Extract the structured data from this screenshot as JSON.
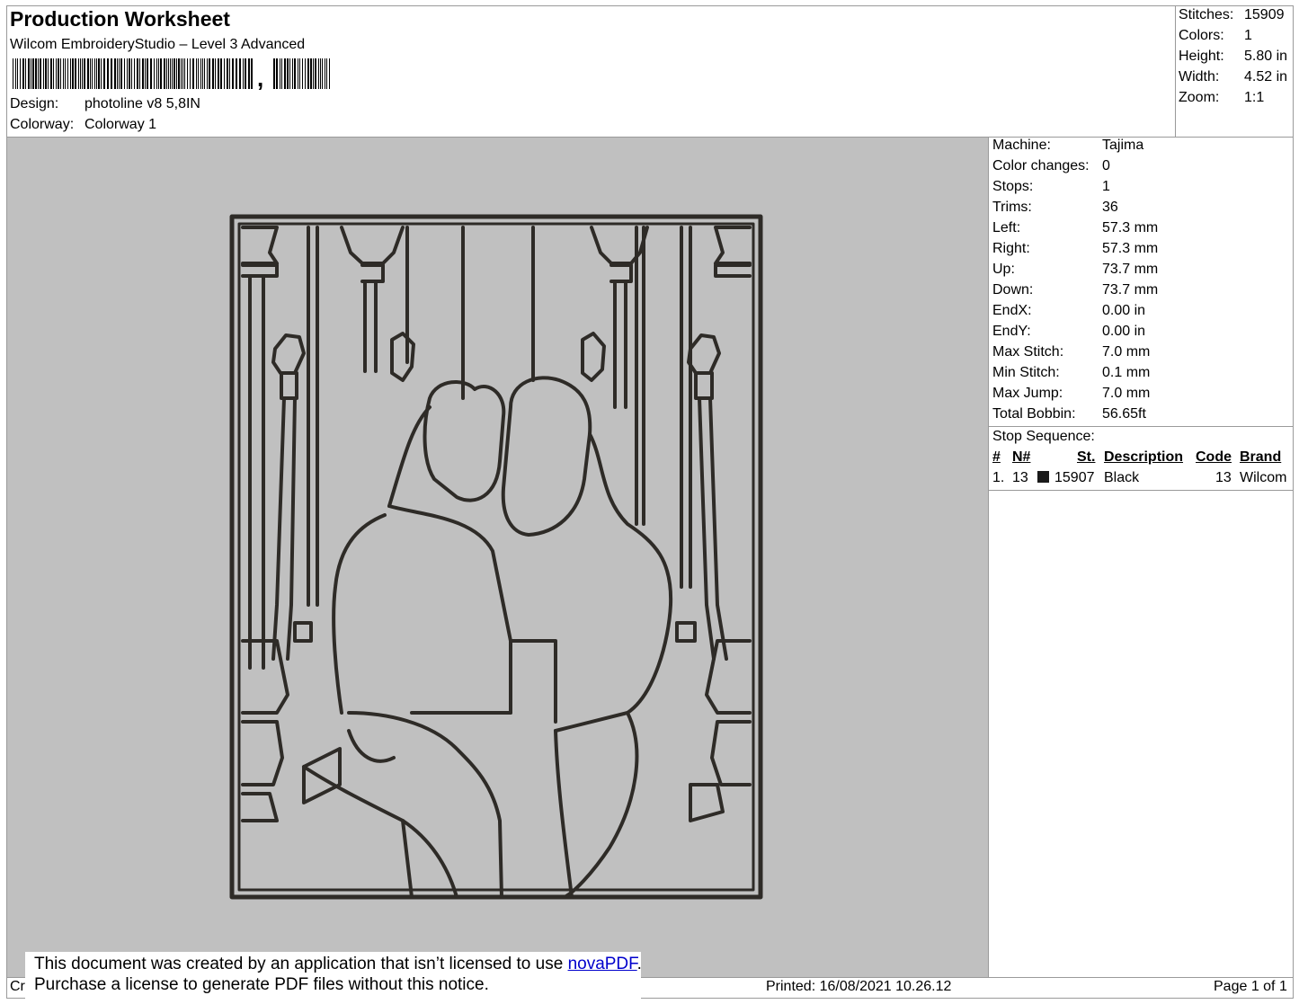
{
  "header": {
    "title": "Production Worksheet",
    "subtitle": "Wilcom EmbroideryStudio – Level 3 Advanced",
    "barcode_char": ",",
    "design_label": "Design:",
    "design_value": "photoline v8 5,8IN",
    "colorway_label": "Colorway:",
    "colorway_value": "Colorway 1"
  },
  "summary": {
    "stitches_label": "Stitches:",
    "stitches_value": "15909",
    "colors_label": "Colors:",
    "colors_value": "1",
    "height_label": "Height:",
    "height_value": "5.80 in",
    "width_label": "Width:",
    "width_value": "4.52 in",
    "zoom_label": "Zoom:",
    "zoom_value": "1:1"
  },
  "specs": [
    {
      "label": "Machine:",
      "value": "Tajima"
    },
    {
      "label": "Color changes:",
      "value": "0"
    },
    {
      "label": "Stops:",
      "value": "1"
    },
    {
      "label": "Trims:",
      "value": "36"
    },
    {
      "label": "Left:",
      "value": "57.3 mm"
    },
    {
      "label": "Right:",
      "value": "57.3 mm"
    },
    {
      "label": "Up:",
      "value": "73.7 mm"
    },
    {
      "label": "Down:",
      "value": "73.7 mm"
    },
    {
      "label": "EndX:",
      "value": "0.00 in"
    },
    {
      "label": "EndY:",
      "value": "0.00 in"
    },
    {
      "label": "Max Stitch:",
      "value": "7.0 mm"
    },
    {
      "label": "Min Stitch:",
      "value": "0.1 mm"
    },
    {
      "label": "Max Jump:",
      "value": "7.0 mm"
    },
    {
      "label": "Total Bobbin:",
      "value": "56.65ft"
    }
  ],
  "stop_sequence": {
    "title": "Stop Sequence:",
    "headers": {
      "num": "#",
      "needle": "N#",
      "stitches": "St.",
      "description": "Description",
      "code": "Code",
      "brand": "Brand"
    },
    "rows": [
      {
        "num": "1.",
        "needle": "13",
        "swatch_color": "#1a1a1a",
        "stitches": "15907",
        "description": "Black",
        "code": "13",
        "brand": "Wilcom"
      }
    ]
  },
  "footer": {
    "created_prefix": "Cr",
    "printed": "Printed: 16/08/2021 10.26.12",
    "page": "Page 1 of 1"
  },
  "notice": {
    "line1_text": "This document was created by an application that isn’t licensed to use ",
    "line1_link": "novaPDF",
    "line1_end": ".",
    "line2": "Purchase a license to generate PDF files without this notice."
  },
  "colors": {
    "canvas_bg": "#c0c0c0",
    "stitch": "#2e2b27",
    "border": "#9a9a9a"
  }
}
